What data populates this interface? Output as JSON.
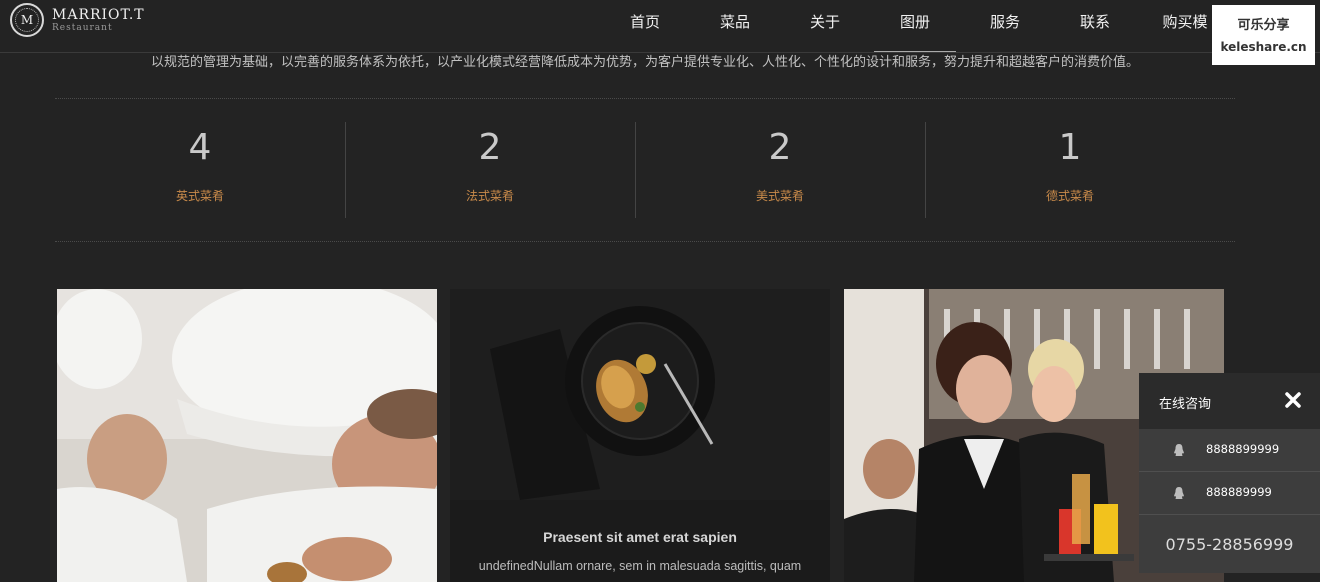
{
  "header": {
    "logo_mark": "M",
    "logo_name": "MARRIOT.T",
    "logo_sub": "Restaurant",
    "nav": [
      {
        "label": "首页"
      },
      {
        "label": "菜品"
      },
      {
        "label": "关于"
      },
      {
        "label": "图册"
      },
      {
        "label": "服务"
      },
      {
        "label": "联系"
      },
      {
        "label": "购买模"
      }
    ],
    "active_nav_index": 3
  },
  "share": {
    "title": "可乐分享",
    "site": "keleshare.cn"
  },
  "intro": "以规范的管理为基础，以完善的服务体系为依托，以产业化模式经营降低成本为优势，为客户提供专业化、人性化、个性化的设计和服务，努力提升和超越客户的消费价值。",
  "stats": [
    {
      "number": "4",
      "label": "英式菜肴"
    },
    {
      "number": "2",
      "label": "法式菜肴"
    },
    {
      "number": "2",
      "label": "美式菜肴"
    },
    {
      "number": "1",
      "label": "德式菜肴"
    }
  ],
  "gallery": {
    "card2_title": "Praesent sit amet erat sapien",
    "card2_text": "undefinedNullam ornare, sem in malesuada sagittis, quam"
  },
  "consult": {
    "title": "在线咨询",
    "qq": [
      "8888899999",
      "888889999"
    ],
    "phone": "0755-28856999"
  },
  "colors": {
    "background": "#232323",
    "accent": "#c88a4a"
  }
}
